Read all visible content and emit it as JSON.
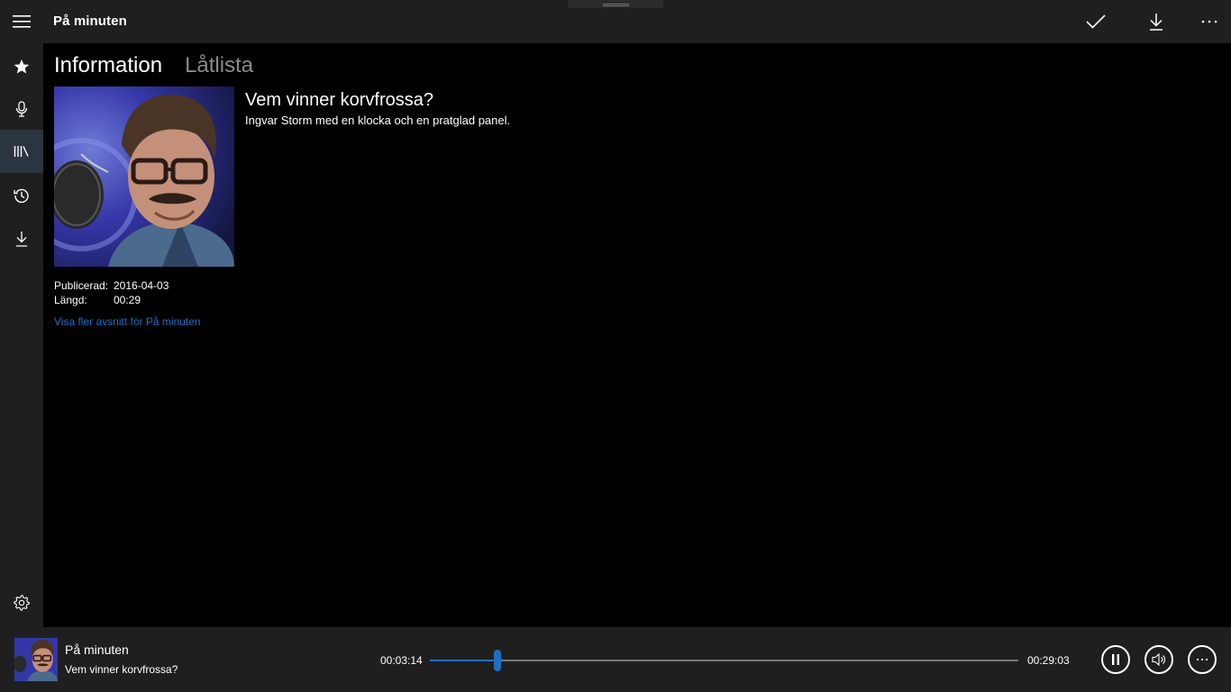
{
  "app": {
    "title": "På minuten"
  },
  "titlebar": {
    "menu_icon": "hamburger-icon",
    "actions": [
      {
        "name": "mark-played",
        "icon": "checkmark-icon"
      },
      {
        "name": "download",
        "icon": "download-icon"
      },
      {
        "name": "more",
        "icon": "more-icon"
      }
    ]
  },
  "nav": {
    "items": [
      {
        "name": "favorites",
        "icon": "star-icon",
        "active": false
      },
      {
        "name": "live",
        "icon": "microphone-icon",
        "active": false
      },
      {
        "name": "library",
        "icon": "library-icon",
        "active": true
      },
      {
        "name": "history",
        "icon": "history-icon",
        "active": false
      },
      {
        "name": "downloads",
        "icon": "download-icon",
        "active": false
      }
    ],
    "settings_icon": "gear-icon"
  },
  "tabs": [
    {
      "label": "Information",
      "active": true
    },
    {
      "label": "Låtlista",
      "active": false
    }
  ],
  "episode": {
    "title": "Vem vinner korvfrossa?",
    "description": "Ingvar Storm med en klocka och en pratglad panel.",
    "published_label": "Publicerad:",
    "published_value": "2016-04-03",
    "length_label": "Längd:",
    "length_value": "00:29",
    "more_link": "Visa fler avsnitt för På minuten"
  },
  "player": {
    "program": "På minuten",
    "episode": "Vem vinner korvfrossa?",
    "current_time": "00:03:14",
    "total_time": "00:29:03",
    "progress_fraction": 0.1153,
    "accent_color": "#1e6fc2",
    "buttons": [
      {
        "name": "pause",
        "icon": "pause-icon"
      },
      {
        "name": "volume",
        "icon": "volume-icon"
      },
      {
        "name": "more",
        "icon": "more-icon"
      }
    ]
  }
}
